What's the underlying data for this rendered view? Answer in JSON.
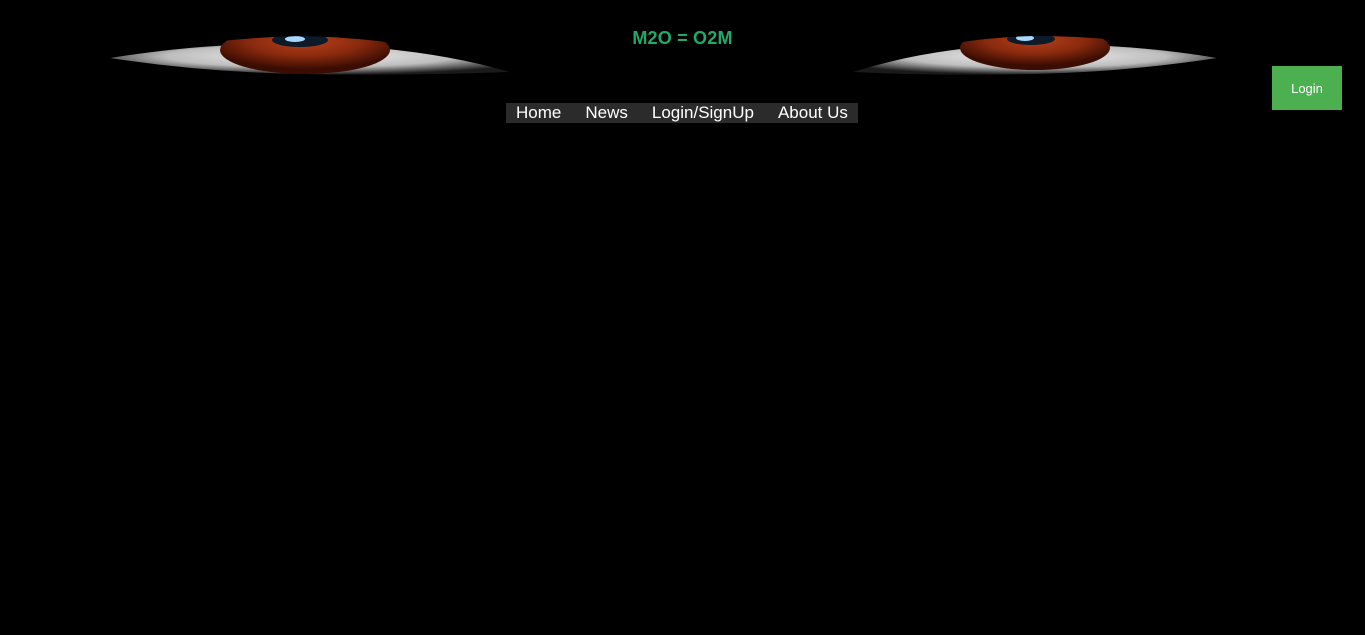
{
  "header": {
    "title": "M2O = O2M",
    "title_color": "#1faa6a",
    "banner_images": [
      "left-eye-image",
      "right-eye-image"
    ]
  },
  "login_button": {
    "label": "Login",
    "color": "#4caf50"
  },
  "nav": {
    "items": [
      {
        "label": "Home"
      },
      {
        "label": "News"
      },
      {
        "label": "Login/SignUp"
      },
      {
        "label": "About Us"
      }
    ],
    "background": "#2b2b2b"
  }
}
